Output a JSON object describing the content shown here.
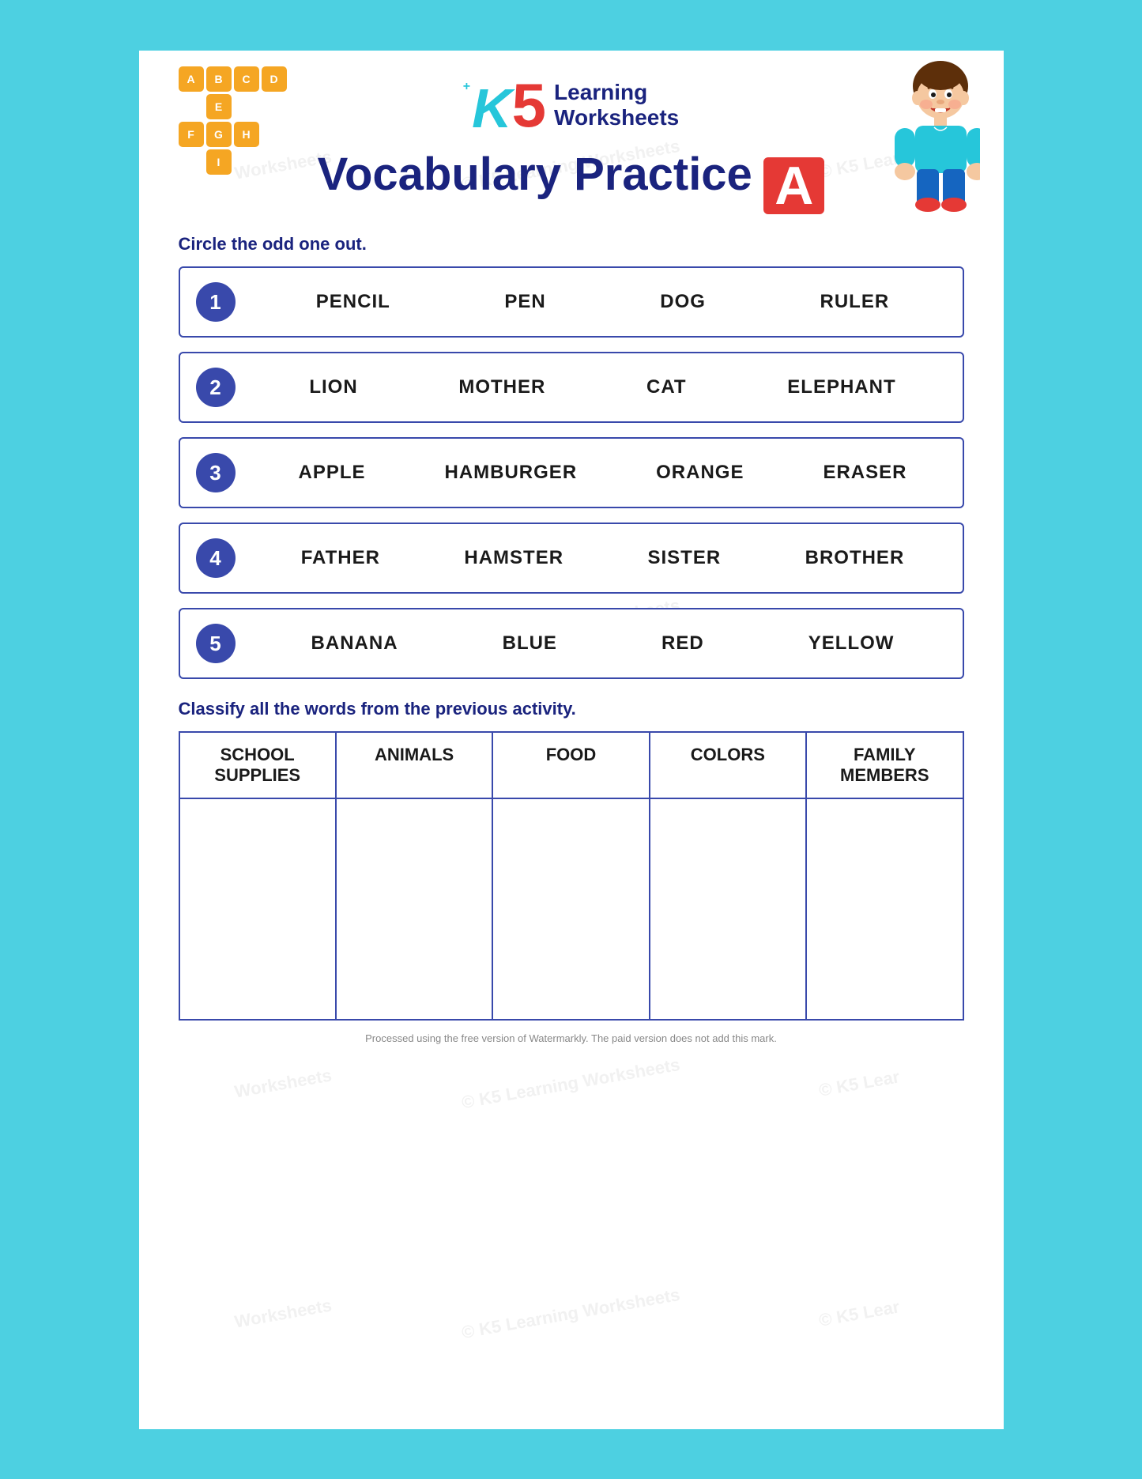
{
  "header": {
    "brand_k": "K",
    "brand_5": "5",
    "brand_plus": "+",
    "brand_learning": "Learning",
    "brand_worksheets": "Worksheets",
    "title": "Vocabulary Practice",
    "title_letter": "A"
  },
  "watermark": {
    "text": "© K5 Learning Worksheets",
    "texts": [
      "Worksheets",
      "© K5 Learning Worksheets",
      "© K5 Lear",
      "Worksheets",
      "© K5 Learning Worksheets",
      "© K5 Lear",
      "Worksheets",
      "© K5 Learning Worksheets",
      "© K5 Lear",
      "Worksheets",
      "© K5 Learning Worksheets",
      "© K5 Lear",
      "Worksheets",
      "© K5 Learning Worksheets",
      "© K5 Lear",
      "Worksheets",
      "© K5 Learning Worksheets",
      "© K5 Lear"
    ]
  },
  "instruction": "Circle the odd one out.",
  "exercises": [
    {
      "number": "1",
      "words": [
        "PENCIL",
        "PEN",
        "DOG",
        "RULER"
      ]
    },
    {
      "number": "2",
      "words": [
        "LION",
        "MOTHER",
        "CAT",
        "ELEPHANT"
      ]
    },
    {
      "number": "3",
      "words": [
        "APPLE",
        "HAMBURGER",
        "ORANGE",
        "ERASER"
      ]
    },
    {
      "number": "4",
      "words": [
        "FATHER",
        "HAMSTER",
        "SISTER",
        "BROTHER"
      ]
    },
    {
      "number": "5",
      "words": [
        "BANANA",
        "BLUE",
        "RED",
        "YELLOW"
      ]
    }
  ],
  "classify_instruction": "Classify all the words from the previous activity.",
  "classify_headers": [
    "SCHOOL SUPPLIES",
    "ANIMALS",
    "FOOD",
    "COLORS",
    "FAMILY MEMBERS"
  ],
  "crossword_tiles": {
    "row1": [
      "A",
      "B",
      "C",
      "D"
    ],
    "row2": [
      "",
      "E",
      "",
      ""
    ],
    "row3": [
      "F",
      "G",
      "H",
      ""
    ],
    "row4": [
      "",
      "I",
      "",
      ""
    ],
    "row5": [
      "",
      "",
      "",
      ""
    ]
  },
  "bottom_note": "Processed using the free version of Watermarkly. The paid version does not add this mark."
}
